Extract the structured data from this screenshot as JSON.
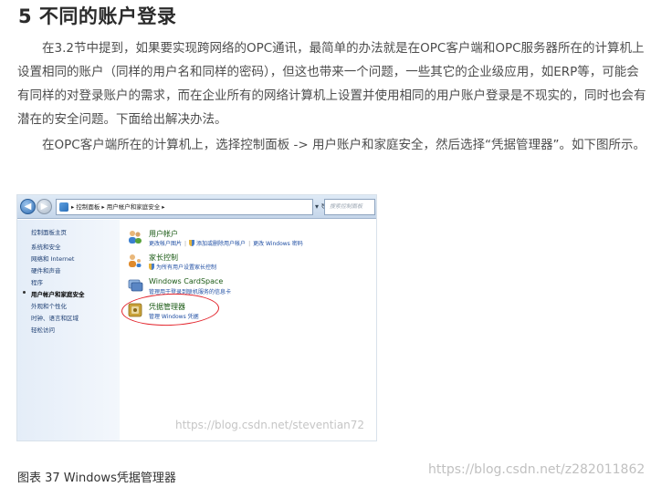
{
  "heading": "5 不同的账户登录",
  "paragraphs": [
    "在3.2节中提到，如果要实现跨网络的OPC通讯，最简单的办法就是在OPC客户端和OPC服务器所在的计算机上设置相同的账户（同样的用户名和同样的密码），但这也带来一个问题，一些其它的企业级应用，如ERP等，可能会有同样的对登录账户的需求，而在企业所有的网络计算机上设置并使用相同的用户账户登录是不现实的，同时也会有潜在的安全问题。下面给出解决办法。",
    "在OPC客户端所在的计算机上，选择控制面板 -> 用户账户和家庭安全，然后选择“凭据管理器”。如下图所示。"
  ],
  "screenshot": {
    "address_path": "▸ 控制面板 ▸ 用户帐户和家庭安全 ▸",
    "search_placeholder": "搜索控制面板",
    "sidebar": [
      {
        "label": "控制面板主页",
        "active": false
      },
      {
        "label": "系统和安全",
        "active": false
      },
      {
        "label": "网络和 Internet",
        "active": false
      },
      {
        "label": "硬件和声音",
        "active": false
      },
      {
        "label": "程序",
        "active": false
      },
      {
        "label": "用户帐户和家庭安全",
        "active": true
      },
      {
        "label": "外观和个性化",
        "active": false
      },
      {
        "label": "时钟、语言和区域",
        "active": false
      },
      {
        "label": "轻松访问",
        "active": false
      }
    ],
    "categories": [
      {
        "title": "用户帐户",
        "links": [
          "更改帐户图片",
          "添加或删除用户帐户",
          "更改 Windows 密码"
        ],
        "icon_name": "users-icon",
        "color": "#3b7fd0"
      },
      {
        "title": "家长控制",
        "links": [
          "为所有用户设置家长控制"
        ],
        "icon_name": "family-icon",
        "color": "#e08a2b"
      },
      {
        "title": "Windows CardSpace",
        "links": [
          "管理用于登录到联机服务的信息卡"
        ],
        "icon_name": "cardspace-icon",
        "color": "#5a86c4"
      },
      {
        "title": "凭据管理器",
        "links": [
          "管理 Windows 凭据"
        ],
        "icon_name": "vault-icon",
        "color": "#c9a23a"
      }
    ],
    "watermark": "https://blog.csdn.net/steventian72"
  },
  "watermark": "https://blog.csdn.net/z282011862",
  "caption": "图表 37 Windows凭据管理器"
}
